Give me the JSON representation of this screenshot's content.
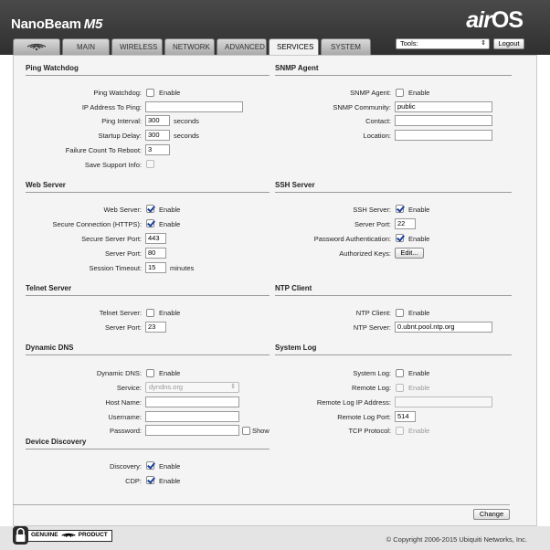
{
  "header": {
    "product": "NanoBeam",
    "model": "M5",
    "logo_air": "air",
    "logo_os": "OS",
    "tabs": [
      "MAIN",
      "WIRELESS",
      "NETWORK",
      "ADVANCED",
      "SERVICES",
      "SYSTEM"
    ],
    "active_tab": "SERVICES",
    "tools_label": "Tools:",
    "logout_label": "Logout"
  },
  "ping": {
    "title": "Ping Watchdog",
    "watchdog_label": "Ping Watchdog:",
    "watchdog_enable": "Enable",
    "watchdog_checked": false,
    "ip_label": "IP Address To Ping:",
    "ip_value": "",
    "interval_label": "Ping Interval:",
    "interval_value": "300",
    "interval_unit": "seconds",
    "startup_label": "Startup Delay:",
    "startup_value": "300",
    "startup_unit": "seconds",
    "failure_label": "Failure Count To Reboot:",
    "failure_value": "3",
    "support_label": "Save Support Info:"
  },
  "snmp": {
    "title": "SNMP Agent",
    "agent_label": "SNMP Agent:",
    "agent_enable": "Enable",
    "agent_checked": false,
    "community_label": "SNMP Community:",
    "community_value": "public",
    "contact_label": "Contact:",
    "contact_value": "",
    "location_label": "Location:",
    "location_value": ""
  },
  "web": {
    "title": "Web Server",
    "server_label": "Web Server:",
    "server_enable": "Enable",
    "https_label": "Secure Connection (HTTPS):",
    "https_enable": "Enable",
    "secure_port_label": "Secure Server Port:",
    "secure_port_value": "443",
    "port_label": "Server Port:",
    "port_value": "80",
    "timeout_label": "Session Timeout:",
    "timeout_value": "15",
    "timeout_unit": "minutes"
  },
  "ssh": {
    "title": "SSH Server",
    "server_label": "SSH Server:",
    "server_enable": "Enable",
    "port_label": "Server Port:",
    "port_value": "22",
    "pw_label": "Password Authentication:",
    "pw_enable": "Enable",
    "keys_label": "Authorized Keys:",
    "keys_button": "Edit..."
  },
  "telnet": {
    "title": "Telnet Server",
    "server_label": "Telnet Server:",
    "server_enable": "Enable",
    "port_label": "Server Port:",
    "port_value": "23"
  },
  "ntp": {
    "title": "NTP Client",
    "client_label": "NTP Client:",
    "client_enable": "Enable",
    "server_label": "NTP Server:",
    "server_value": "0.ubnt.pool.ntp.org"
  },
  "ddns": {
    "title": "Dynamic DNS",
    "ddns_label": "Dynamic DNS:",
    "ddns_enable": "Enable",
    "service_label": "Service:",
    "service_value": "dyndns.org",
    "host_label": "Host Name:",
    "host_value": "",
    "user_label": "Username:",
    "user_value": "",
    "pass_label": "Password:",
    "pass_value": "",
    "show_label": "Show"
  },
  "syslog": {
    "title": "System Log",
    "syslog_label": "System Log:",
    "syslog_enable": "Enable",
    "remote_label": "Remote Log:",
    "remote_enable": "Enable",
    "remote_ip_label": "Remote Log IP Address:",
    "remote_ip_value": "",
    "remote_port_label": "Remote Log Port:",
    "remote_port_value": "514",
    "tcp_label": "TCP Protocol:",
    "tcp_enable": "Enable"
  },
  "discovery": {
    "title": "Device Discovery",
    "discovery_label": "Discovery:",
    "discovery_enable": "Enable",
    "cdp_label": "CDP:",
    "cdp_enable": "Enable"
  },
  "change_button": "Change",
  "footer": {
    "genuine": "GENUINE",
    "product": "PRODUCT",
    "copyright": "© Copyright 2006-2015 Ubiquiti Networks, Inc."
  }
}
